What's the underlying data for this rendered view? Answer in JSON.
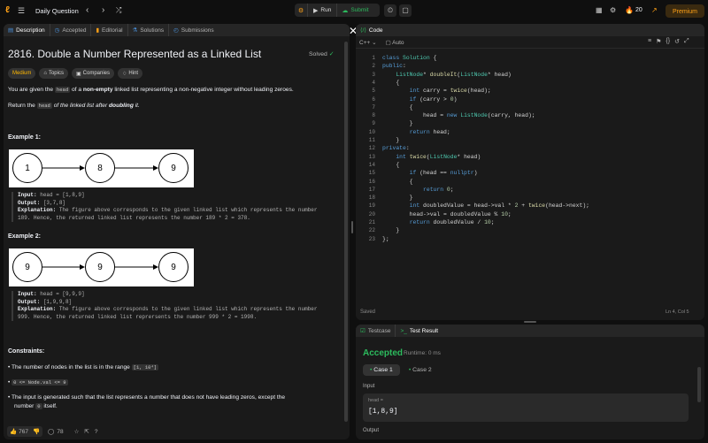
{
  "topbar": {
    "title": "Daily Question",
    "run_label": "Run",
    "submit_label": "Submit",
    "streak": "20",
    "premium_label": "Premium"
  },
  "left_tabs": [
    "Description",
    "Accepted",
    "Editorial",
    "Solutions",
    "Submissions"
  ],
  "problem": {
    "title": "2816. Double a Number Represented as a Linked List",
    "status": "Solved",
    "difficulty": "Medium",
    "chips": [
      "Topics",
      "Companies",
      "Hint"
    ],
    "p1_pre": "You are given the",
    "p1_code": "head",
    "p1_mid": "of a",
    "p1_bold": "non-empty",
    "p1_post": "linked list representing a non-negative integer without leading zeroes.",
    "p2_pre": "Return the",
    "p2_code": "head",
    "p2_mid": "of the linked list after",
    "p2_bold": "doubling",
    "p2_post": "it.",
    "ex1_title": "Example 1:",
    "ex1_nodes": [
      "1",
      "8",
      "9"
    ],
    "ex1_input_label": "Input:",
    "ex1_input": "head = [1,8,9]",
    "ex1_output_label": "Output:",
    "ex1_output": "[3,7,8]",
    "ex1_expl_label": "Explanation:",
    "ex1_expl_1": "The figure above corresponds to the given linked list which represents the number",
    "ex1_expl_2": "189. Hence, the returned linked list represents the number 189 * 2 = 378.",
    "ex2_title": "Example 2:",
    "ex2_nodes": [
      "9",
      "9",
      "9"
    ],
    "ex2_input_label": "Input:",
    "ex2_input": "head = [9,9,9]",
    "ex2_output_label": "Output:",
    "ex2_output": "[1,9,9,8]",
    "ex2_expl_label": "Explanation:",
    "ex2_expl_1": "The figure above corresponds to the given linked list which represents the number",
    "ex2_expl_2": "999. Hence, the returned linked list reprersents the number 999 * 2 = 1998.",
    "constraints_title": "Constraints:",
    "c1_pre": "The number of nodes in the list is in the range",
    "c1_code": "[1, 10⁴]",
    "c2_code": "0 <= Node.val <= 9",
    "c3_pre": "The input is generated such that the list represents a number that does not have leading zeros, except the",
    "c3_pre2": "number",
    "c3_code": "0",
    "c3_post": "itself."
  },
  "footer": {
    "likes": "767",
    "comments": "78"
  },
  "code_panel": {
    "title": "Code",
    "language": "C++",
    "mode": "Auto",
    "saved": "Saved",
    "cursor": "Ln 4, Col 5"
  },
  "code_lines": [
    {
      "n": "1",
      "t": "class Solution {"
    },
    {
      "n": "2",
      "t": "public:"
    },
    {
      "n": "3",
      "t": "    ListNode* doubleIt(ListNode* head)"
    },
    {
      "n": "4",
      "t": "    {"
    },
    {
      "n": "5",
      "t": "        int carry = twice(head);"
    },
    {
      "n": "6",
      "t": "        if (carry > 0)"
    },
    {
      "n": "7",
      "t": "        {"
    },
    {
      "n": "8",
      "t": "            head = new ListNode(carry, head);"
    },
    {
      "n": "9",
      "t": "        }"
    },
    {
      "n": "10",
      "t": "        return head;"
    },
    {
      "n": "11",
      "t": "    }"
    },
    {
      "n": "12",
      "t": "private:"
    },
    {
      "n": "13",
      "t": "    int twice(ListNode* head)"
    },
    {
      "n": "14",
      "t": "    {"
    },
    {
      "n": "15",
      "t": "        if (head == nullptr)"
    },
    {
      "n": "16",
      "t": "        {"
    },
    {
      "n": "17",
      "t": "            return 0;"
    },
    {
      "n": "18",
      "t": "        }"
    },
    {
      "n": "19",
      "t": "        int doubledValue = head->val * 2 + twice(head->next);"
    },
    {
      "n": "20",
      "t": "        head->val = doubledValue % 10;"
    },
    {
      "n": "21",
      "t": "        return doubledValue / 10;"
    },
    {
      "n": "22",
      "t": "    }"
    },
    {
      "n": "23",
      "t": "};"
    }
  ],
  "result_panel": {
    "tab_testcase": "Testcase",
    "tab_result": "Test Result",
    "status": "Accepted",
    "runtime": "Runtime: 0 ms",
    "case1": "Case 1",
    "case2": "Case 2",
    "input_label": "Input",
    "var_label": "head =",
    "var_value": "[1,8,9]",
    "output_label": "Output"
  },
  "colors": {
    "accent": "#ffa116",
    "accepted": "#2cbb5d",
    "bg": "#0f0f0f",
    "panel": "#1a1a1a"
  }
}
